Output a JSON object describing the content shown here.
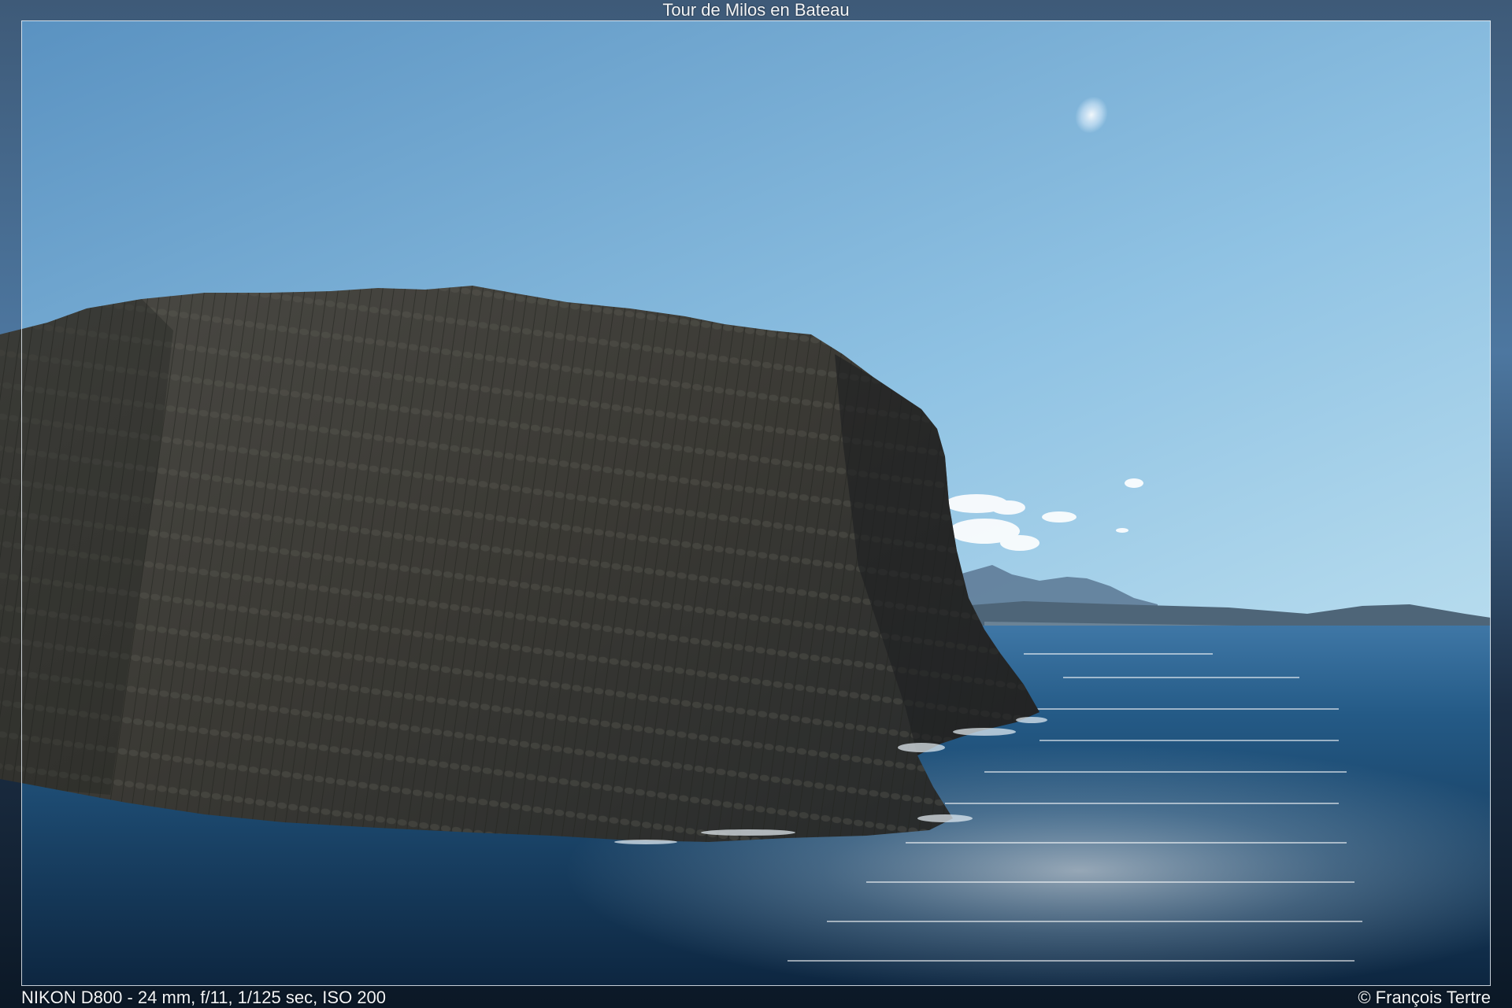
{
  "gallery": {
    "title": "Tour de Milos en Bateau",
    "exif": "NIKON D800 - 24 mm, f/11, 1/125 sec, ISO 200",
    "copyright": "© François Tertre"
  },
  "photo": {
    "subject": "columnar basalt sea cliff",
    "colors": {
      "sky_top": "#5e95c2",
      "sky_bottom": "#a9d3ea",
      "sea_dark": "#0e2740",
      "sea_mid": "#1f4f78",
      "rock": "#3a3a36",
      "mountains": "#5f7c98"
    }
  }
}
